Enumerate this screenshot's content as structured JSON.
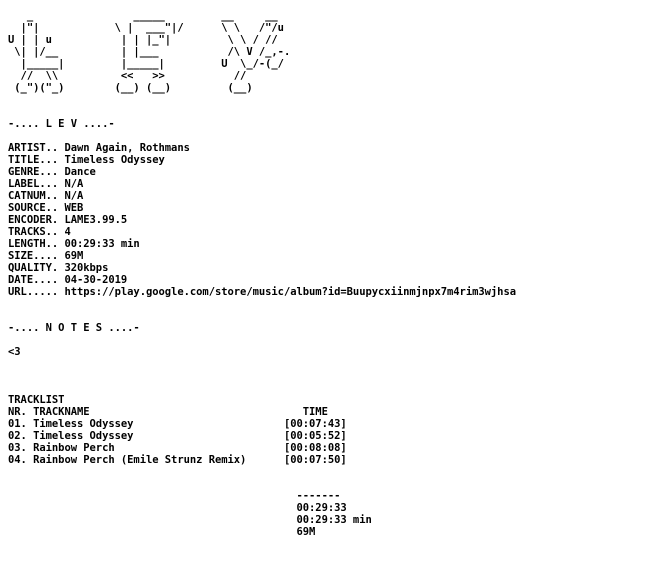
{
  "nfo": {
    "lines": [
      "   _                _____         __     __",
      "  |\"|            \\ |  ___\"|/      \\ \\   /\"/u",
      "U | | u           | | |_\"|         \\ \\ / //",
      " \\| |/__          | |___           /\\ V /_,-.",
      "  |_____|         |_____|         U  \\_/-(_/",
      "  //  \\\\          <<   >>           //",
      " (_\")(\"_)        (__) (__)         (__)",
      "",
      "",
      "-.... L E V ....-",
      "",
      "ARTIST.. Dawn Again, Rothmans",
      "TITLE... Timeless Odyssey",
      "GENRE... Dance",
      "LABEL... N/A",
      "CATNUM.. N/A",
      "SOURCE.. WEB",
      "ENCODER. LAME3.99.5",
      "TRACKS.. 4",
      "LENGTH.. 00:29:33 min",
      "SIZE.... 69M",
      "QUALITY. 320kbps",
      "DATE.... 04-30-2019",
      "URL..... https://play.google.com/store/music/album?id=Buupycxiinmjnpx7m4rim3wjhsa",
      "",
      "",
      "-.... N O T E S ....-",
      "",
      "<3",
      "",
      "",
      "",
      "TRACKLIST",
      "NR. TRACKNAME                                  TIME",
      "01. Timeless Odyssey                        [00:07:43]",
      "02. Timeless Odyssey                        [00:05:52]",
      "03. Rainbow Perch                           [00:08:08]",
      "04. Rainbow Perch (Emile Strunz Remix)      [00:07:50]",
      "",
      "",
      "                                              -------",
      "                                              00:29:33",
      "                                              00:29:33 min",
      "                                              69M"
    ]
  }
}
